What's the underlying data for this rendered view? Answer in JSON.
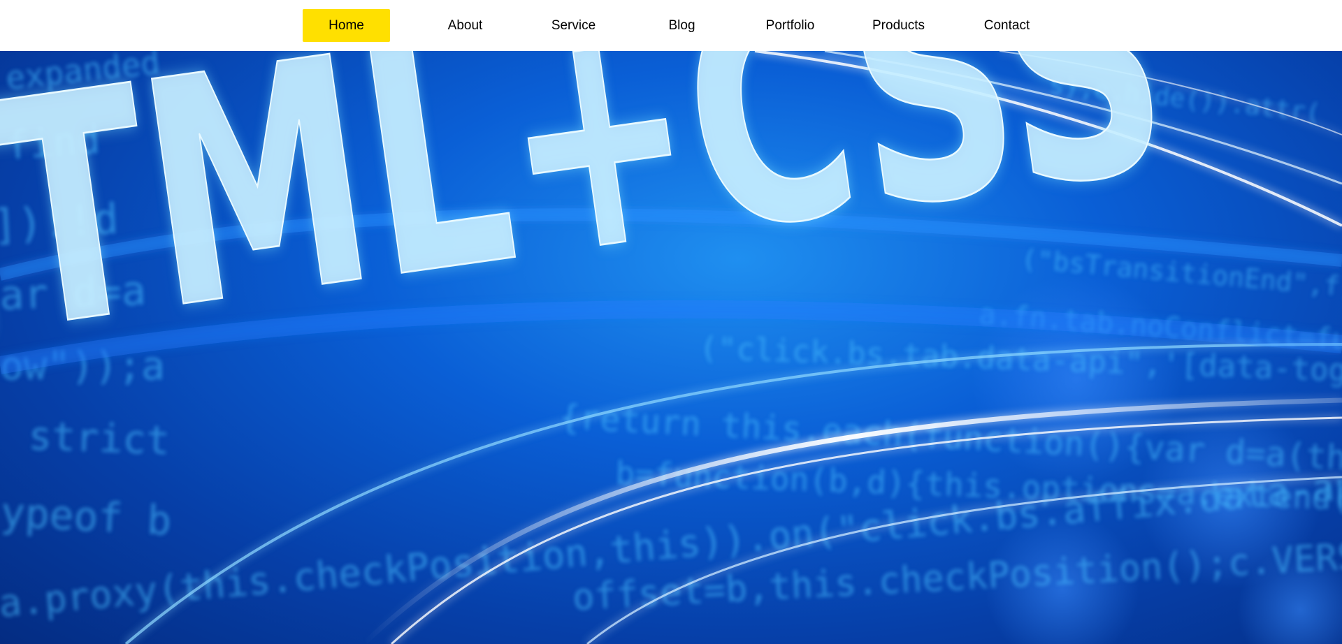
{
  "nav": {
    "active_color": "#FFE000",
    "items": [
      {
        "label": "Home",
        "active": true
      },
      {
        "label": "About",
        "active": false
      },
      {
        "label": "Service",
        "active": false
      },
      {
        "label": "Blog",
        "active": false
      },
      {
        "label": "Portfolio",
        "active": false
      },
      {
        "label": "Products",
        "active": false
      },
      {
        "label": "Contact",
        "active": false
      }
    ]
  },
  "hero": {
    "headline": "HTML+CSS",
    "background_color": "#0a5fd6",
    "code_lines": [
      "expanded",
      "find",
      "])!!d",
      "ar d=a",
      "ow\"));a",
      "strict",
      "ypeof b",
      "a.proxy(this.checkPosition,this)).on(\"click.bs.affix.data-api",
      "offset=b,this.checkPosition();c.VERSION",
      "(\"click.bs.tab.data-api\",'[data-toggle=\"tab\"]'",
      "{return this.each(function(){var d=a(this),e=",
      "b=function(b,d){this.options=a.extend({},c",
      "(\"bsTransitionEnd\",f).emulate",
      "a.fn.tab.noConflict=func",
      "s),e.hide()).attr("
    ]
  }
}
